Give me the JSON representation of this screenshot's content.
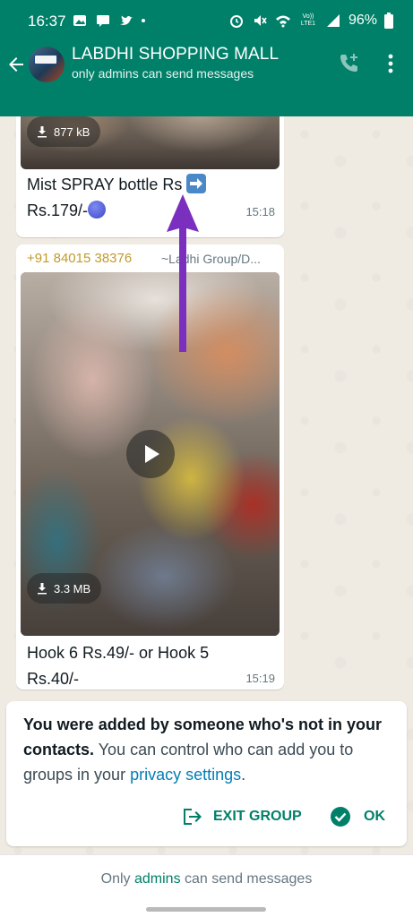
{
  "status_bar": {
    "time": "16:37",
    "battery": "96%",
    "network_label": "Vo)) LTE1"
  },
  "header": {
    "title": "LABDHI SHOPPING MALL",
    "subtitle": "only admins can send messages"
  },
  "messages": [
    {
      "media_size": "877 kB",
      "text_part1": "Mist SPRAY bottle Rs",
      "text_part2": "Rs.179/-",
      "time": "15:18"
    },
    {
      "sender_phone": "+91 84015 38376",
      "sender_name": "~Ladhi Group/D...",
      "media_size": "3.3 MB",
      "text": "Hook 6 Rs.49/-   or Hook 5 Rs.40/-",
      "time": "15:19"
    }
  ],
  "notice": {
    "strong": "You were added by someone who's not in your contacts.",
    "text": " You can control who can add you to groups in your ",
    "link": "privacy settings",
    "end": ".",
    "exit_label": "EXIT GROUP",
    "ok_label": "OK"
  },
  "footer": {
    "prefix": "Only ",
    "link": "admins",
    "suffix": " can send messages"
  },
  "colors": {
    "brand": "#008069",
    "link": "#027eb5",
    "arrow": "#7b2fbf",
    "sender": "#c29b2b"
  }
}
